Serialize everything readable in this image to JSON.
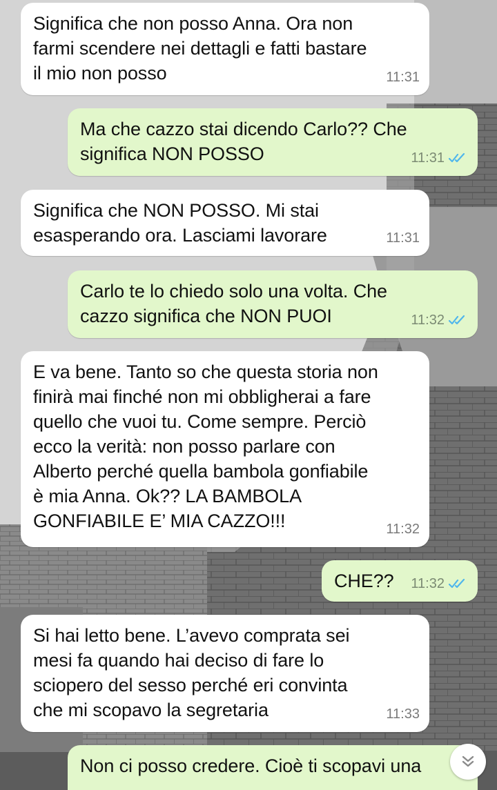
{
  "chat": {
    "messages": [
      {
        "direction": "in",
        "text": "Significa che non posso Anna. Ora non\nfarmi scendere nei dettagli e fatti bastare\nil mio non posso",
        "time": "11:31"
      },
      {
        "direction": "out",
        "text": "Ma che cazzo stai dicendo Carlo?? Che\nsignifica NON POSSO",
        "time": "11:31",
        "status": "read"
      },
      {
        "direction": "in",
        "text": "Significa che NON POSSO. Mi stai\nesasperando ora. Lasciami lavorare",
        "time": "11:31"
      },
      {
        "direction": "out",
        "text": "Carlo te lo chiedo solo una volta. Che\ncazzo significa che NON PUOI",
        "time": "11:32",
        "status": "read"
      },
      {
        "direction": "in",
        "text": "E va bene. Tanto so che questa storia non\nfinirà mai finché non mi obbligherai a fare\nquello che vuoi tu. Come sempre. Perciò\necco la verità: non posso parlare con\nAlberto perché quella bambola gonfiabile\nè mia Anna. Ok?? LA BAMBOLA\nGONFIABILE E’ MIA CAZZO!!!",
        "time": "11:32"
      },
      {
        "direction": "out",
        "text": "CHE??",
        "time": "11:32",
        "status": "read"
      },
      {
        "direction": "in",
        "text": "Si hai letto bene. L’avevo comprata sei\nmesi fa quando hai deciso di fare lo\nsciopero del sesso perché eri convinta\nche mi scopavo la segretaria",
        "time": "11:33"
      },
      {
        "direction": "out",
        "text": "Non ci posso credere. Cioè ti scopavi una",
        "time": "",
        "status": "none"
      }
    ]
  },
  "colors": {
    "incoming_bubble": "#ffffff",
    "outgoing_bubble": "#e2f7cb",
    "read_tick": "#4fb6ec",
    "timestamp": "#7a7a7a"
  },
  "icons": {
    "read_status": "double-check-icon",
    "scroll": "chevron-double-down-icon"
  }
}
